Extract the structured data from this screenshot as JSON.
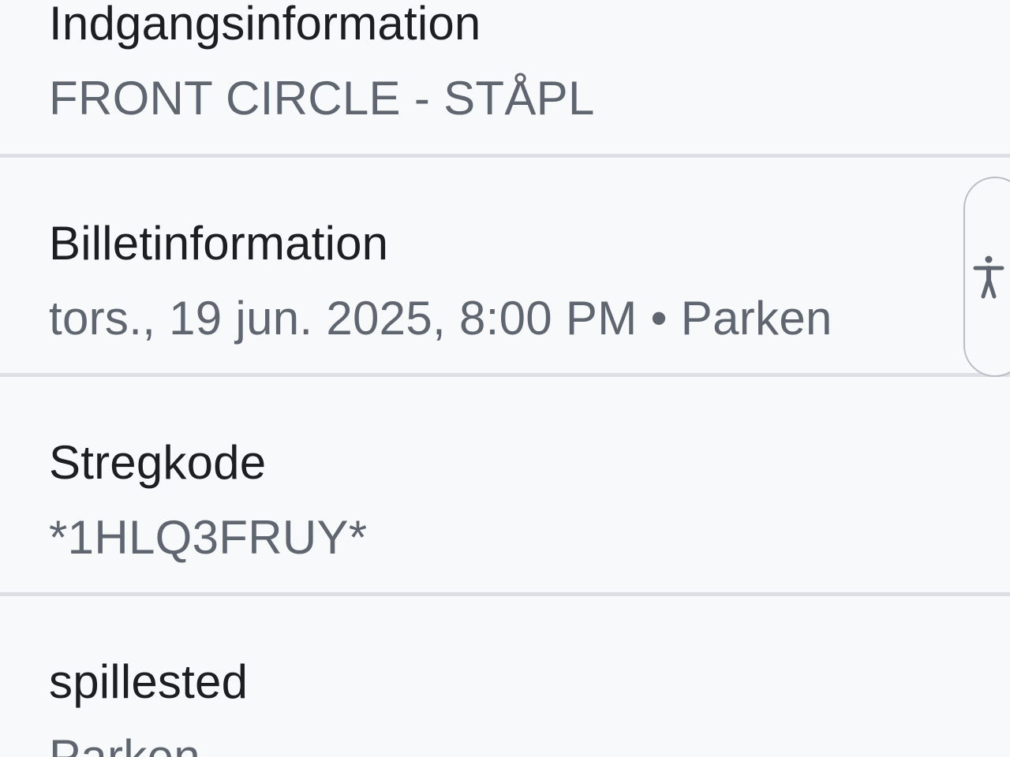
{
  "sections": [
    {
      "label": "Indgangsinformation",
      "value": "FRONT CIRCLE - STÅPL"
    },
    {
      "label": "Billetinformation",
      "value": "tors., 19 jun. 2025, 8:00 PM • Parken"
    },
    {
      "label": "Stregkode",
      "value": "*1HLQ3FRUY*"
    },
    {
      "label": "spillested",
      "value": "Parken"
    }
  ],
  "accessibility_button": {
    "icon": "accessibility-person-icon"
  }
}
